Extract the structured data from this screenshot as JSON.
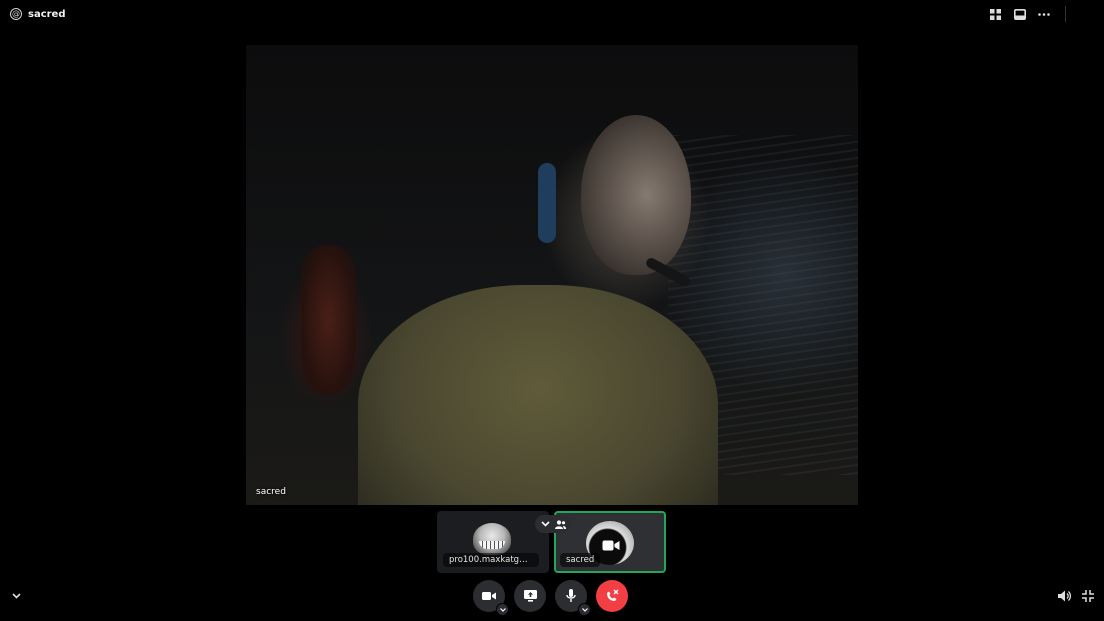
{
  "header": {
    "channel_name": "sacred",
    "icons": [
      "at-icon",
      "grid-layout-icon",
      "inbox-icon",
      "more-options-icon"
    ]
  },
  "main_video": {
    "participant_name": "sacred"
  },
  "participants": [
    {
      "name": "pro100.maxkatgmai...",
      "avatar": "troll-face-avatar",
      "active": false
    },
    {
      "name": "sacred",
      "avatar": "dark-avatar",
      "active": true,
      "camera_off": true
    }
  ],
  "tile_controls": {
    "icons": [
      "chevron-down-icon",
      "participants-icon"
    ]
  },
  "call_controls": {
    "buttons": [
      {
        "icon": "camera-icon",
        "has_caret": true
      },
      {
        "icon": "screen-share-icon",
        "has_caret": false
      },
      {
        "icon": "microphone-icon",
        "has_caret": true
      },
      {
        "icon": "hang-up-icon",
        "has_caret": false
      }
    ],
    "hangup_color": "#f23f43"
  },
  "corner_controls": {
    "left": "chevron-down-icon",
    "right": [
      "volume-icon",
      "exit-fullscreen-icon"
    ]
  },
  "colors": {
    "background": "#000000",
    "active_border": "#23a55a",
    "button_bg": "#2b2d31"
  }
}
